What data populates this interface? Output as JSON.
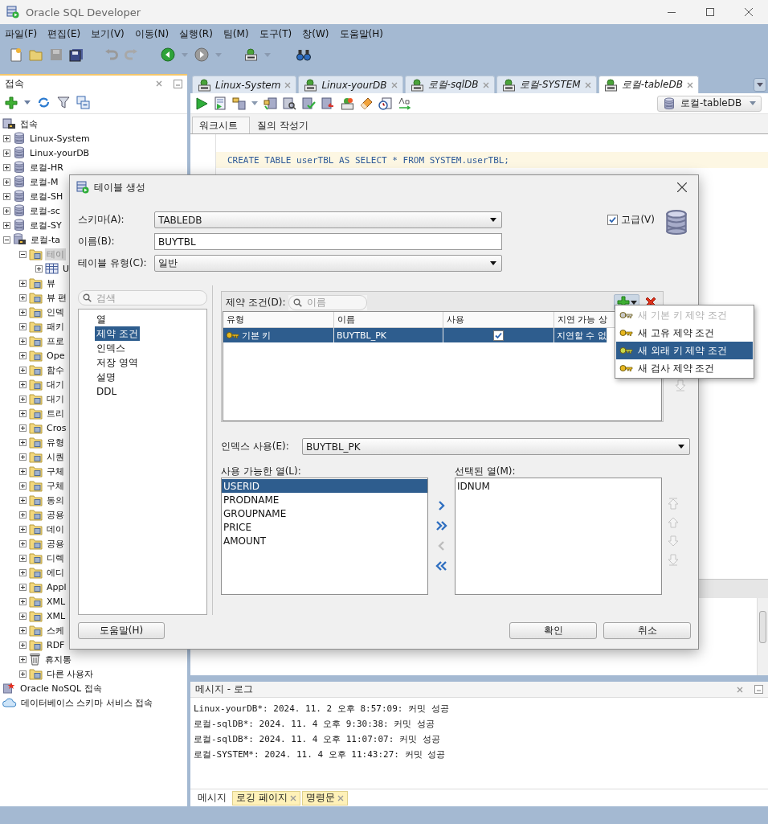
{
  "window": {
    "title": "Oracle SQL Developer"
  },
  "menu": [
    "파일(F)",
    "편집(E)",
    "보기(V)",
    "이동(N)",
    "실행(R)",
    "팀(M)",
    "도구(T)",
    "창(W)",
    "도움말(H)"
  ],
  "connections_panel": {
    "title": "접속",
    "tree": [
      {
        "label": "접속",
        "kind": "connections",
        "selected": false,
        "children": [
          {
            "label": "Linux-System",
            "kind": "database",
            "expanded": false,
            "selected": false
          },
          {
            "label": "Linux-yourDB",
            "kind": "database",
            "expanded": false,
            "selected": false
          },
          {
            "label": "로컬-HR",
            "kind": "database",
            "expanded": false,
            "selected": false
          },
          {
            "label": "로컬-M",
            "kind": "database",
            "expanded": false,
            "selected": false
          },
          {
            "label": "로컬-SH",
            "kind": "database",
            "expanded": false,
            "selected": false
          },
          {
            "label": "로컬-sc",
            "kind": "database",
            "expanded": false,
            "selected": false
          },
          {
            "label": "로컬-SY",
            "kind": "database",
            "expanded": false,
            "selected": false
          },
          {
            "label": "로컬-ta",
            "kind": "database-open",
            "expanded": true,
            "selected": false,
            "children": [
              {
                "label": "테이",
                "kind": "folder",
                "expanded": true,
                "selected": true,
                "children": [
                  {
                    "label": "U",
                    "kind": "table",
                    "expanded": false,
                    "selected": false
                  }
                ]
              },
              {
                "label": "뷰",
                "kind": "folder",
                "expanded": false,
                "selected": false
              },
              {
                "label": "뷰 편",
                "kind": "folder",
                "expanded": false,
                "selected": false
              },
              {
                "label": "인덱",
                "kind": "folder",
                "expanded": false,
                "selected": false
              },
              {
                "label": "패키",
                "kind": "folder",
                "expanded": false,
                "selected": false
              },
              {
                "label": "프로",
                "kind": "folder",
                "expanded": false,
                "selected": false
              },
              {
                "label": "Ope",
                "kind": "folder",
                "expanded": false,
                "selected": false
              },
              {
                "label": "함수",
                "kind": "folder",
                "expanded": false,
                "selected": false
              },
              {
                "label": "대기",
                "kind": "folder",
                "expanded": false,
                "selected": false
              },
              {
                "label": "대기",
                "kind": "folder",
                "expanded": false,
                "selected": false
              },
              {
                "label": "트리",
                "kind": "folder",
                "expanded": false,
                "selected": false
              },
              {
                "label": "Cros",
                "kind": "folder",
                "expanded": false,
                "selected": false
              },
              {
                "label": "유형",
                "kind": "folder",
                "expanded": false,
                "selected": false
              },
              {
                "label": "시퀀",
                "kind": "folder",
                "expanded": false,
                "selected": false
              },
              {
                "label": "구체",
                "kind": "folder",
                "expanded": false,
                "selected": false
              },
              {
                "label": "구체",
                "kind": "folder",
                "expanded": false,
                "selected": false
              },
              {
                "label": "동의",
                "kind": "folder",
                "expanded": false,
                "selected": false
              },
              {
                "label": "공용",
                "kind": "folder",
                "expanded": false,
                "selected": false
              },
              {
                "label": "데이",
                "kind": "folder",
                "expanded": false,
                "selected": false
              },
              {
                "label": "공용",
                "kind": "folder",
                "expanded": false,
                "selected": false
              },
              {
                "label": "디렉",
                "kind": "folder",
                "expanded": false,
                "selected": false
              },
              {
                "label": "에디",
                "kind": "folder",
                "expanded": false,
                "selected": false
              },
              {
                "label": "Appl",
                "kind": "folder",
                "expanded": false,
                "selected": false
              },
              {
                "label": "XML",
                "kind": "folder",
                "expanded": false,
                "selected": false
              },
              {
                "label": "XML",
                "kind": "folder",
                "expanded": false,
                "selected": false
              },
              {
                "label": "스케",
                "kind": "folder",
                "expanded": false,
                "selected": false
              },
              {
                "label": "RDF",
                "kind": "folder",
                "expanded": false,
                "selected": false
              },
              {
                "label": "휴지통",
                "kind": "trash",
                "expanded": false,
                "selected": false
              },
              {
                "label": "다른 사용자",
                "kind": "folder",
                "expanded": false,
                "selected": false
              }
            ]
          }
        ]
      },
      {
        "label": "Oracle NoSQL 접속",
        "kind": "nosql",
        "selected": false
      },
      {
        "label": "데이터베이스 스키마 서비스 접속",
        "kind": "cloud",
        "selected": false
      }
    ]
  },
  "editor": {
    "tabs": [
      {
        "label": "Linux-System",
        "selected": false
      },
      {
        "label": "Linux-yourDB",
        "selected": false
      },
      {
        "label": "로컬-sqlDB",
        "selected": false
      },
      {
        "label": "로컬-SYSTEM",
        "selected": false
      },
      {
        "label": "로컬-tableDB",
        "selected": true
      }
    ],
    "connection": "로컬-tableDB",
    "sheet_tabs": [
      {
        "label": "워크시트",
        "selected": true
      },
      {
        "label": "질의 작성기",
        "selected": false
      }
    ],
    "sql": "CREATE TABLE userTBL AS SELECT * FROM SYSTEM.userTBL;"
  },
  "log": {
    "title": "메시지 - 로그",
    "lines": [
      "Linux-yourDB*: 2024. 11. 2 오후 8:57:09: 커밋 성공",
      "로컬-sqlDB*: 2024. 11. 4 오후 9:30:38: 커밋 성공",
      "로컬-sqlDB*: 2024. 11. 4 오후 11:07:07: 커밋 성공",
      "로컬-SYSTEM*: 2024. 11. 4 오후 11:43:27: 커밋 성공"
    ],
    "tabs": [
      {
        "label": "메시지",
        "selected": true,
        "closable": false
      },
      {
        "label": "로깅 페이지",
        "selected": false,
        "closable": true
      },
      {
        "label": "명령문",
        "selected": false,
        "closable": true
      }
    ]
  },
  "dialog": {
    "title": "테이블 생성",
    "schema": {
      "label": "스키마(A):",
      "value": "TABLEDB"
    },
    "name": {
      "label": "이름(B):",
      "value": "BUYTBL"
    },
    "table_type": {
      "label": "테이블 유형(C):",
      "value": "일반"
    },
    "advanced": {
      "label": "고급(V)",
      "checked": true
    },
    "nav_search": {
      "placeholder": "검색"
    },
    "nav": [
      {
        "label": "열",
        "selected": false
      },
      {
        "label": "제약 조건",
        "selected": true
      },
      {
        "label": "인덱스",
        "selected": false
      },
      {
        "label": "저장 영역",
        "selected": false
      },
      {
        "label": "설명",
        "selected": false
      },
      {
        "label": "DDL",
        "selected": false
      }
    ],
    "constraints": {
      "label": "제약 조건(D):",
      "search_placeholder": "이름",
      "columns": [
        "유형",
        "이름",
        "사용",
        "지연 가능 상"
      ],
      "rows": [
        {
          "type": "기본 키",
          "name": "BUYTBL_PK",
          "enabled": true,
          "deferrable": "지연할 수 없",
          "selected": true
        }
      ]
    },
    "add_menu": [
      {
        "label": "새 기본 키 제약 조건",
        "disabled": true,
        "selected": false
      },
      {
        "label": "새 고유 제약 조건",
        "disabled": false,
        "selected": false
      },
      {
        "label": "새 외래 키 제약 조건",
        "disabled": false,
        "selected": true
      },
      {
        "label": "새 검사 제약 조건",
        "disabled": false,
        "selected": false
      }
    ],
    "index": {
      "label": "인덱스 사용(E):",
      "value": "BUYTBL_PK"
    },
    "available": {
      "label": "사용 가능한 열(L):",
      "items": [
        {
          "label": "USERID",
          "selected": true
        },
        {
          "label": "PRODNAME",
          "selected": false
        },
        {
          "label": "GROUPNAME",
          "selected": false
        },
        {
          "label": "PRICE",
          "selected": false
        },
        {
          "label": "AMOUNT",
          "selected": false
        }
      ]
    },
    "transfer": [
      {
        "kind": "add",
        "disabled": false
      },
      {
        "kind": "add-all",
        "disabled": false
      },
      {
        "kind": "remove",
        "disabled": true
      },
      {
        "kind": "remove-all",
        "disabled": false
      }
    ],
    "chosen": {
      "label": "선택된 열(M):",
      "items": [
        {
          "label": "IDNUM",
          "selected": false
        }
      ]
    },
    "order": [
      {
        "kind": "top",
        "disabled": true
      },
      {
        "kind": "up",
        "disabled": true
      },
      {
        "kind": "down",
        "disabled": true
      },
      {
        "kind": "bottom",
        "disabled": true
      }
    ],
    "help": "도움말(H)",
    "ok": "확인",
    "cancel": "취소"
  }
}
